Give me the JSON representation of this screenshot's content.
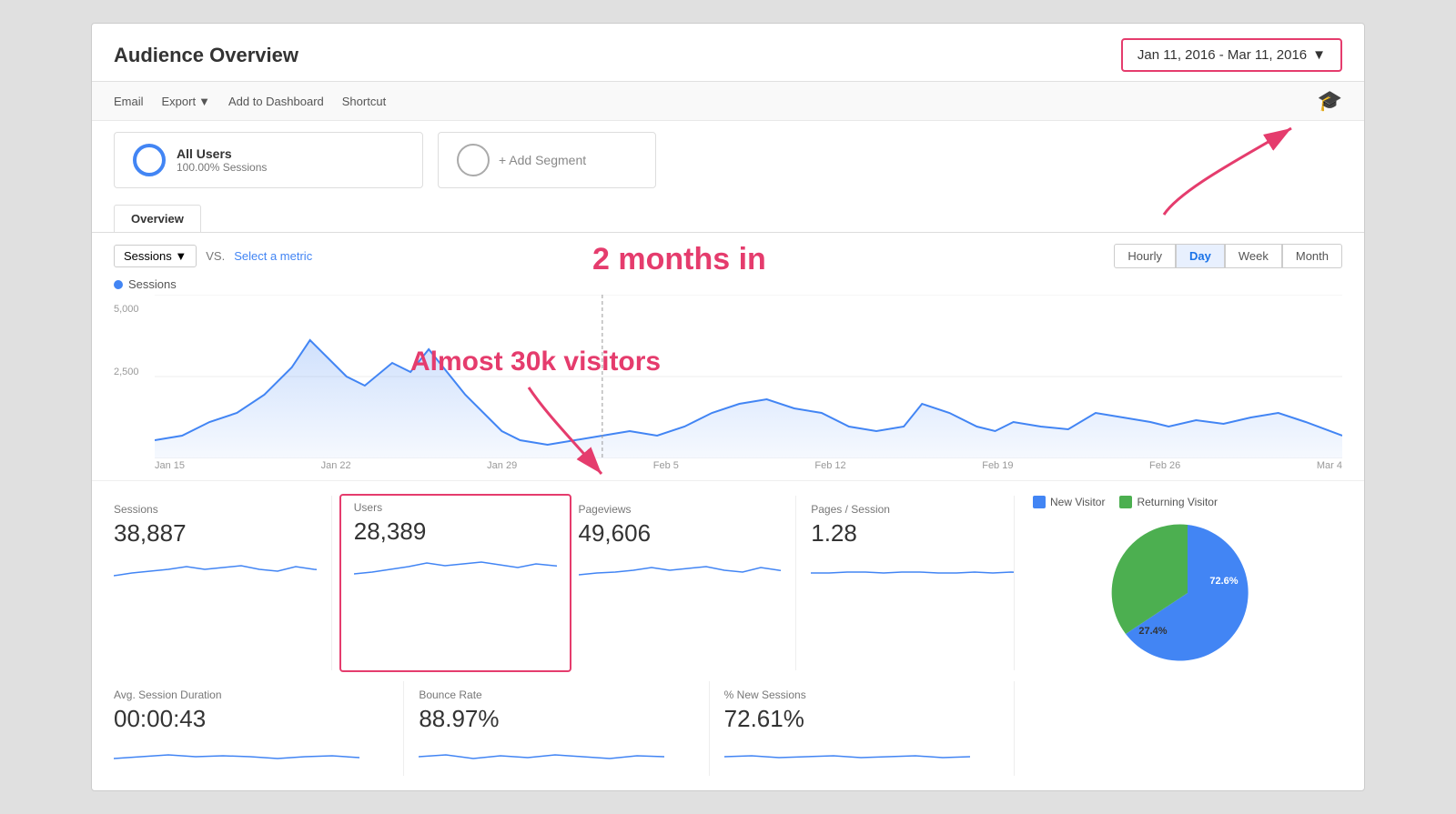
{
  "header": {
    "title": "Audience Overview",
    "date_range": "Jan 11, 2016 - Mar 11, 2016",
    "date_range_arrow": "▼"
  },
  "toolbar": {
    "email": "Email",
    "export": "Export",
    "export_arrow": "▼",
    "add_to_dashboard": "Add to Dashboard",
    "shortcut": "Shortcut"
  },
  "segments": {
    "all_users_label": "All Users",
    "all_users_sub": "100.00% Sessions",
    "add_segment": "+ Add Segment"
  },
  "tabs": {
    "overview": "Overview"
  },
  "chart": {
    "metric_label": "Sessions",
    "metric_arrow": "▼",
    "vs_label": "VS.",
    "select_metric": "Select a metric",
    "time_buttons": [
      "Hourly",
      "Day",
      "Week",
      "Month"
    ],
    "active_time": "Day",
    "y_labels": [
      "5,000",
      "2,500"
    ],
    "x_labels": [
      "Jan 15",
      "Jan 22",
      "Jan 29",
      "Feb 5",
      "Feb 12",
      "Feb 19",
      "Feb 26",
      "Mar 4"
    ],
    "sessions_legend": "Sessions"
  },
  "stats": [
    {
      "label": "Sessions",
      "value": "38,887",
      "highlighted": false
    },
    {
      "label": "Users",
      "value": "28,389",
      "highlighted": true
    },
    {
      "label": "Pageviews",
      "value": "49,606",
      "highlighted": false
    },
    {
      "label": "Pages / Session",
      "value": "1.28",
      "highlighted": false
    }
  ],
  "stats2": [
    {
      "label": "Avg. Session Duration",
      "value": "00:00:43",
      "highlighted": false
    },
    {
      "label": "Bounce Rate",
      "value": "88.97%",
      "highlighted": false
    },
    {
      "label": "% New Sessions",
      "value": "72.61%",
      "highlighted": false
    }
  ],
  "pie": {
    "legend": [
      {
        "label": "New Visitor",
        "color": "#4285f4",
        "pct": 72.6
      },
      {
        "label": "Returning Visitor",
        "color": "#4caf50",
        "pct": 27.4
      }
    ],
    "new_pct": "72.6%",
    "returning_pct": "27.4%"
  },
  "annotations": {
    "two_months": "2 months in",
    "thirty_k": "Almost 30k visitors"
  }
}
